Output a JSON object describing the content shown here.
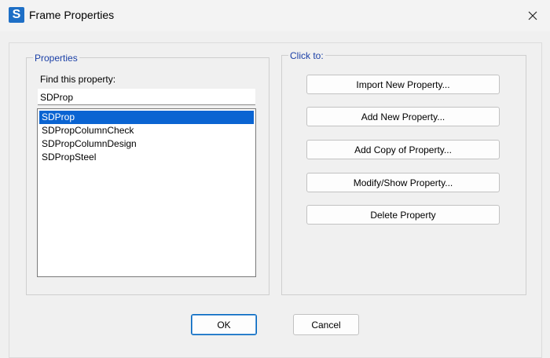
{
  "window": {
    "title": "Frame Properties",
    "app_icon_letter": "S"
  },
  "properties_group": {
    "label": "Properties",
    "find_label": "Find this property:",
    "find_value": "SDProp",
    "list": [
      "SDProp",
      "SDPropColumnCheck",
      "SDPropColumnDesign",
      "SDPropSteel"
    ],
    "selected_index": 0
  },
  "click_group": {
    "label": "Click to:",
    "buttons": [
      "Import New Property...",
      "Add New Property...",
      "Add Copy of Property...",
      "Modify/Show Property...",
      "Delete Property"
    ]
  },
  "footer": {
    "ok_label": "OK",
    "cancel_label": "Cancel"
  },
  "colors": {
    "accent": "#0a64d2",
    "group_label": "#1a3fa6",
    "app_icon": "#1e6fc6"
  }
}
